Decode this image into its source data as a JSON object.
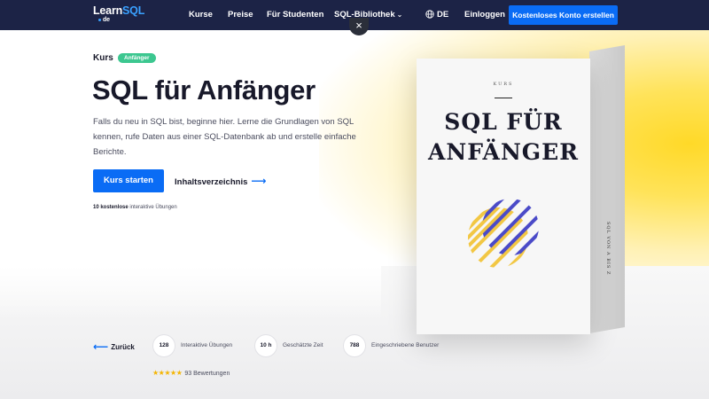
{
  "nav": {
    "logo_learn": "Learn",
    "logo_sql": "SQL",
    "logo_tld": "de",
    "links": [
      {
        "label": "Kurse"
      },
      {
        "label": "Preise"
      },
      {
        "label": "Für Studenten"
      },
      {
        "label": "SQL-Bibliothek"
      }
    ],
    "language": "DE",
    "login": "Einloggen",
    "signup": "Kostenloses Konto erstellen"
  },
  "close_label": "×",
  "hero": {
    "course_label": "Kurs",
    "badge": "Anfänger",
    "title": "SQL für Anfänger",
    "description": "Falls du neu in SQL bist, beginne hier. Lerne die Grundlagen von SQL kennen, rufe Daten aus einer SQL-Datenbank ab und erstelle einfache Berichte.",
    "cta_start": "Kurs starten",
    "cta_toc": "Inhaltsverzeichnis",
    "free_note_bold": "10 kostenlose",
    "free_note_rest": " interaktive Übungen"
  },
  "box": {
    "kurs": "KURS",
    "title_line1": "SQL FÜR",
    "title_line2": "ANFÄNGER",
    "spine": "SQL VON A BIS Z"
  },
  "stats": {
    "back": "Zurück",
    "exercises_count": "128",
    "exercises_label": "Interaktive Übungen",
    "time_value": "10 h",
    "time_label": "Geschätzte Zeit",
    "users_count": "788",
    "users_label": "Eingeschriebene Benutzer",
    "stars": "★★★★★",
    "rating_count": "93 Bewertungen",
    "rating_value": 5
  },
  "colors": {
    "nav_bg": "#1c2346",
    "accent_blue": "#0a6cf5",
    "badge_green": "#3cc790",
    "hero_yellow": "#ffd928",
    "star_gold": "#f4b400"
  }
}
